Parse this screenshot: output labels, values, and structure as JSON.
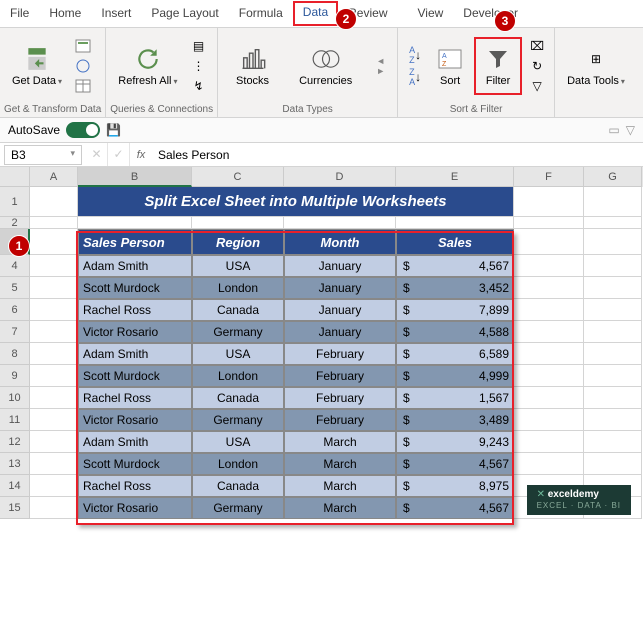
{
  "tabs": [
    "File",
    "Home",
    "Insert",
    "Page Layout",
    "Formula",
    "Data",
    "Review",
    "View",
    "Developer"
  ],
  "activeTab": "Data",
  "ribbon": {
    "getData": "Get Data",
    "refreshAll": "Refresh All",
    "stocks": "Stocks",
    "currencies": "Currencies",
    "sort": "Sort",
    "filter": "Filter",
    "dataTools": "Data Tools",
    "groups": {
      "g1": "Get & Transform Data",
      "g2": "Queries & Connections",
      "g3": "Data Types",
      "g4": "Sort & Filter"
    },
    "sortAZ": "A→Z",
    "sortZA": "Z→A"
  },
  "autosave": {
    "label": "AutoSave"
  },
  "nameBox": "B3",
  "formulaFx": "fx",
  "formulaValue": "Sales Person",
  "columns": [
    "A",
    "B",
    "C",
    "D",
    "E",
    "F",
    "G"
  ],
  "title": "Split Excel Sheet into Multiple Worksheets",
  "headers": {
    "person": "Sales Person",
    "region": "Region",
    "month": "Month",
    "sales": "Sales"
  },
  "currency": "$",
  "rows": [
    {
      "person": "Adam Smith",
      "region": "USA",
      "month": "January",
      "sales": "4,567"
    },
    {
      "person": "Scott Murdock",
      "region": "London",
      "month": "January",
      "sales": "3,452"
    },
    {
      "person": "Rachel Ross",
      "region": "Canada",
      "month": "January",
      "sales": "7,899"
    },
    {
      "person": "Victor Rosario",
      "region": "Germany",
      "month": "January",
      "sales": "4,588"
    },
    {
      "person": "Adam Smith",
      "region": "USA",
      "month": "February",
      "sales": "6,589"
    },
    {
      "person": "Scott Murdock",
      "region": "London",
      "month": "February",
      "sales": "4,999"
    },
    {
      "person": "Rachel Ross",
      "region": "Canada",
      "month": "February",
      "sales": "1,567"
    },
    {
      "person": "Victor Rosario",
      "region": "Germany",
      "month": "February",
      "sales": "3,489"
    },
    {
      "person": "Adam Smith",
      "region": "USA",
      "month": "March",
      "sales": "9,243"
    },
    {
      "person": "Scott Murdock",
      "region": "London",
      "month": "March",
      "sales": "4,567"
    },
    {
      "person": "Rachel Ross",
      "region": "Canada",
      "month": "March",
      "sales": "8,975"
    },
    {
      "person": "Victor Rosario",
      "region": "Germany",
      "month": "March",
      "sales": "4,567"
    }
  ],
  "callouts": {
    "c1": "1",
    "c2": "2",
    "c3": "3"
  },
  "watermark": {
    "brand": "exceldemy",
    "icon": "✕",
    "tag": "EXCEL · DATA · BI"
  }
}
